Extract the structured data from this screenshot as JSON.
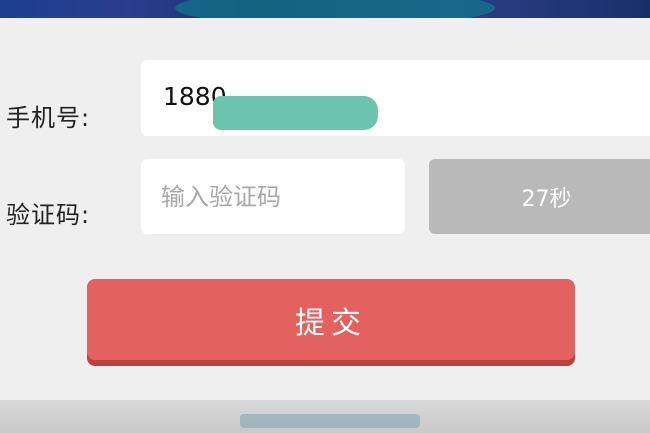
{
  "form": {
    "phone_label": "手机号:",
    "phone_value": "1880",
    "code_label": "验证码:",
    "code_placeholder": "输入验证码",
    "countdown_label": "27秒",
    "submit_label": "提交"
  },
  "colors": {
    "submit": "#e3615e",
    "countdown_disabled": "#b9b9b9",
    "field_bg": "#ffffff",
    "dialog_bg": "#efefef",
    "redaction": "#6cc4ae"
  }
}
